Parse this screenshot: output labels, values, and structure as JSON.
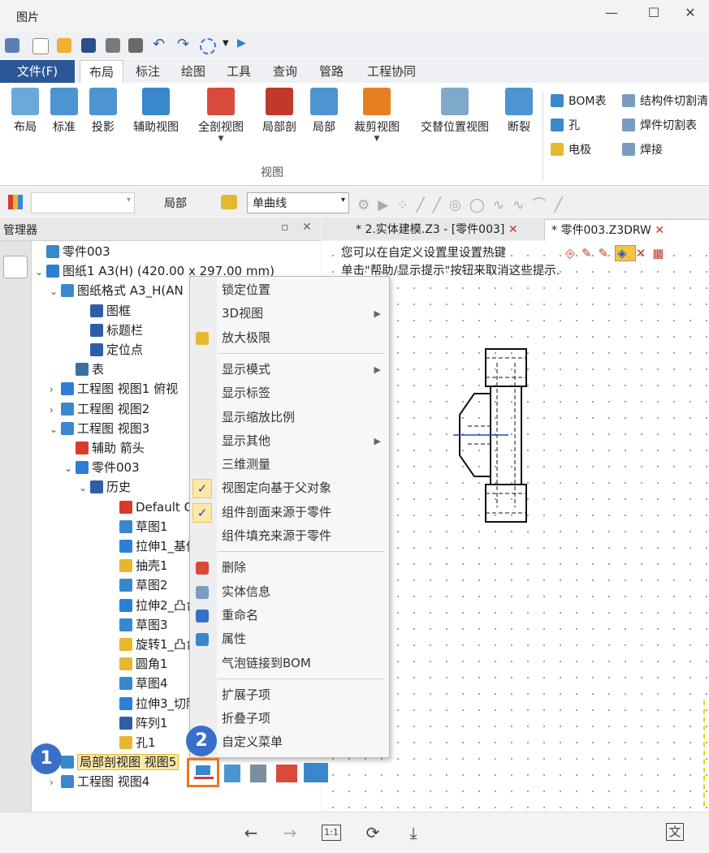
{
  "window": {
    "title": "图片",
    "buttons": {
      "min": "—",
      "max": "☐",
      "close": "✕"
    }
  },
  "menu_tabs": [
    "文件(F)",
    "布局",
    "标注",
    "绘图",
    "工具",
    "查询",
    "管路",
    "工程协同"
  ],
  "ribbon": {
    "buttons": [
      {
        "label": "布局",
        "drop": false
      },
      {
        "label": "标准",
        "drop": false
      },
      {
        "label": "投影",
        "drop": false
      },
      {
        "label": "辅助视图",
        "drop": false
      },
      {
        "label": "全剖视图",
        "drop": true
      },
      {
        "label": "局部剖",
        "drop": false
      },
      {
        "label": "局部",
        "drop": false
      },
      {
        "label": "裁剪视图",
        "drop": true
      },
      {
        "label": "交替位置视图",
        "drop": false
      },
      {
        "label": "断裂",
        "drop": false
      }
    ],
    "group_label": "视图",
    "side_items": [
      "BOM表",
      "孔",
      "电极",
      "结构件切割清",
      "焊件切割表",
      "焊接"
    ]
  },
  "toolbar": {
    "field_value": "",
    "label": "局部",
    "select_value": "单曲线"
  },
  "manager": {
    "title": "管理器",
    "pin": "▫",
    "close": "✕"
  },
  "tree": [
    {
      "label": "零件003",
      "indent": 0,
      "arrow": ""
    },
    {
      "label": "图纸1 A3(H) (420.00 x 297.00 mm)",
      "indent": 0,
      "arrow": "⌄"
    },
    {
      "label": "图纸格式 A3_H(AN",
      "indent": 1,
      "arrow": "⌄"
    },
    {
      "label": "图框",
      "indent": 3,
      "arrow": ""
    },
    {
      "label": "标题栏",
      "indent": 3,
      "arrow": ""
    },
    {
      "label": "定位点",
      "indent": 3,
      "arrow": ""
    },
    {
      "label": "表",
      "indent": 2,
      "arrow": ""
    },
    {
      "label": "工程图 视图1 俯视",
      "indent": 1,
      "arrow": "›"
    },
    {
      "label": "工程图 视图2",
      "indent": 1,
      "arrow": "›"
    },
    {
      "label": "工程图 视图3",
      "indent": 1,
      "arrow": "⌄"
    },
    {
      "label": "辅助 箭头",
      "indent": 2,
      "arrow": ""
    },
    {
      "label": "零件003",
      "indent": 2,
      "arrow": "⌄"
    },
    {
      "label": "历史",
      "indent": 3,
      "arrow": "⌄"
    },
    {
      "label": "Default CS",
      "indent": 5,
      "arrow": ""
    },
    {
      "label": "草图1",
      "indent": 5,
      "arrow": ""
    },
    {
      "label": "拉伸1_基体",
      "indent": 5,
      "arrow": ""
    },
    {
      "label": "抽壳1",
      "indent": 5,
      "arrow": ""
    },
    {
      "label": "草图2",
      "indent": 5,
      "arrow": ""
    },
    {
      "label": "拉伸2_凸台",
      "indent": 5,
      "arrow": ""
    },
    {
      "label": "草图3",
      "indent": 5,
      "arrow": ""
    },
    {
      "label": "旋转1_凸台",
      "indent": 5,
      "arrow": ""
    },
    {
      "label": "圆角1",
      "indent": 5,
      "arrow": ""
    },
    {
      "label": "草图4",
      "indent": 5,
      "arrow": ""
    },
    {
      "label": "拉伸3_切除",
      "indent": 5,
      "arrow": ""
    },
    {
      "label": "阵列1",
      "indent": 5,
      "arrow": ""
    },
    {
      "label": "孔1",
      "indent": 5,
      "arrow": ""
    },
    {
      "label": "局部剖视图 视图5",
      "indent": 1,
      "arrow": "›",
      "selected": true
    },
    {
      "label": "工程图 视图4",
      "indent": 1,
      "arrow": "›"
    }
  ],
  "doc_tabs": [
    {
      "label": "* 2.实体建模.Z3 - [零件003]",
      "close": "✕",
      "active": false
    },
    {
      "label": "* 零件003.Z3DRW",
      "close": "✕",
      "active": true
    }
  ],
  "canvas_hint": [
    "您可以在自定义设置里设置热键",
    "单击\"帮助/显示提示\"按钮来取消这些提示."
  ],
  "context_menu": [
    {
      "label": "锁定位置",
      "sub": false,
      "check": false,
      "icon": ""
    },
    {
      "label": "3D视图",
      "sub": true,
      "check": false,
      "icon": ""
    },
    {
      "label": "放大极限",
      "sub": false,
      "check": false,
      "icon": "zoom-extents-icon"
    },
    {
      "sep": true
    },
    {
      "label": "显示模式",
      "sub": true,
      "check": false,
      "icon": ""
    },
    {
      "label": "显示标签",
      "sub": false,
      "check": false,
      "icon": ""
    },
    {
      "label": "显示缩放比例",
      "sub": false,
      "check": false,
      "icon": ""
    },
    {
      "label": "显示其他",
      "sub": true,
      "check": false,
      "icon": ""
    },
    {
      "label": "三维测量",
      "sub": false,
      "check": false,
      "icon": ""
    },
    {
      "label": "视图定向基于父对象",
      "sub": false,
      "check": true,
      "icon": ""
    },
    {
      "label": "组件剖面来源于零件",
      "sub": false,
      "check": true,
      "icon": ""
    },
    {
      "label": "组件填充来源于零件",
      "sub": false,
      "check": false,
      "icon": ""
    },
    {
      "sep": true
    },
    {
      "label": "删除",
      "sub": false,
      "check": false,
      "icon": "eraser-icon"
    },
    {
      "label": "实体信息",
      "sub": false,
      "check": false,
      "icon": "info-icon"
    },
    {
      "label": "重命名",
      "sub": false,
      "check": false,
      "icon": "rename-icon"
    },
    {
      "label": "属性",
      "sub": false,
      "check": false,
      "icon": "properties-icon"
    },
    {
      "label": "气泡链接到BOM",
      "sub": false,
      "check": false,
      "icon": ""
    },
    {
      "sep": true
    },
    {
      "label": "扩展子项",
      "sub": false,
      "check": false,
      "icon": ""
    },
    {
      "label": "折叠子项",
      "sub": false,
      "check": false,
      "icon": ""
    },
    {
      "label": "自定义菜单",
      "sub": false,
      "check": false,
      "icon": ""
    }
  ],
  "badges": [
    "1",
    "2"
  ],
  "bottom_bar": {
    "back": "←",
    "forward": "→",
    "actual_size": "1:1",
    "rotate": "⟳",
    "download": "⤓",
    "ocr": "文"
  },
  "colors": {
    "accent": "#2b5797",
    "selection": "#fce8a6",
    "highlight_box": "#e87722",
    "badge": "#3a6fc8"
  }
}
